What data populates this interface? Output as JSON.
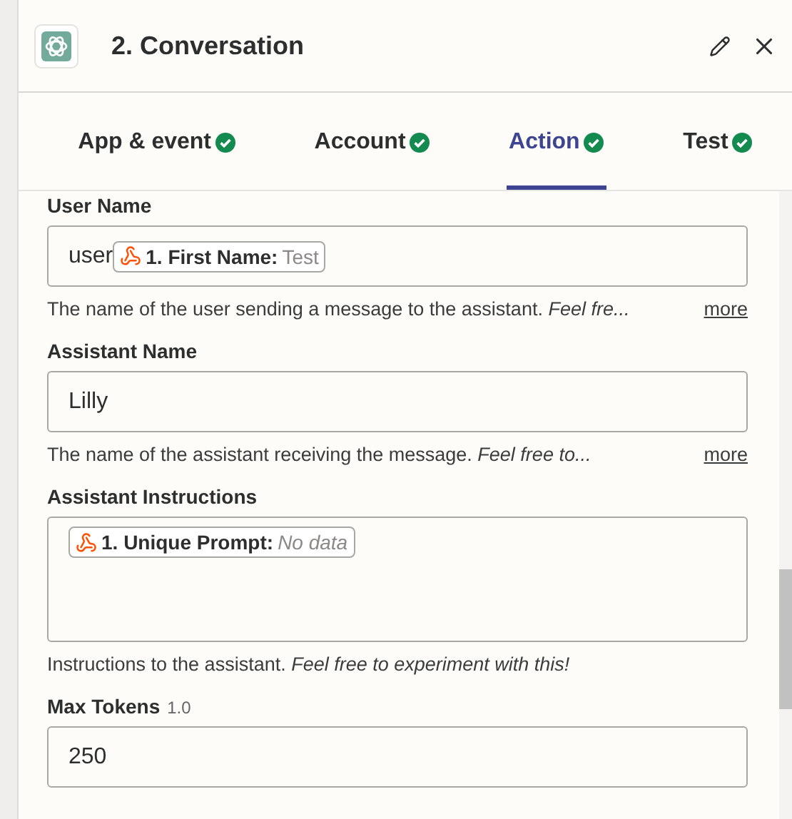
{
  "header": {
    "title": "2. Conversation"
  },
  "tabs": [
    {
      "label": "App & event",
      "selected": false,
      "complete": true
    },
    {
      "label": "Account",
      "selected": false,
      "complete": true
    },
    {
      "label": "Action",
      "selected": true,
      "complete": true
    },
    {
      "label": "Test",
      "selected": false,
      "complete": true
    }
  ],
  "fields": [
    {
      "kind": "input",
      "label": "User Name",
      "text": "user",
      "tokens": [
        {
          "label": "1. First Name:",
          "value": "Test",
          "empty": false
        }
      ],
      "description": "The name of the user sending a message to the assistant. *Feel fre...*",
      "more": "more"
    },
    {
      "kind": "input",
      "label": "Assistant Name",
      "text": "Lilly",
      "description": "The name of the assistant receiving the message. *Feel free to...*",
      "more": "more"
    },
    {
      "kind": "textarea",
      "label": "Assistant Instructions",
      "tokens": [
        {
          "label": "1. Unique Prompt:",
          "value": "No data",
          "empty": true
        }
      ],
      "description": "Instructions to the assistant. *Feel free to experiment with this!*"
    },
    {
      "kind": "input",
      "label": "Max Tokens",
      "hint": "1.0",
      "text": "250"
    }
  ]
}
